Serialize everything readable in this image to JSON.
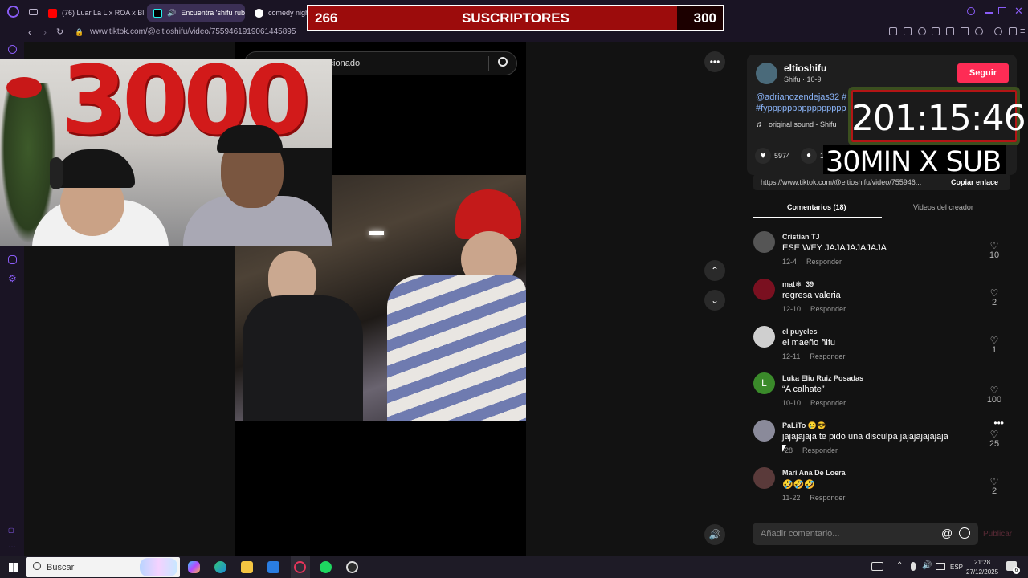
{
  "browser": {
    "tabs": [
      {
        "label": "(76) Luar La L x ROA x Bl",
        "color": "#ff0000"
      },
      {
        "label": "Encuentra 'shifu rub",
        "color": "#111111"
      },
      {
        "label": "comedy nigh",
        "color": "#9aa0a6"
      }
    ],
    "url": "www.tiktok.com/@eltioshifu/video/7559461919061445895"
  },
  "overlay": {
    "sub_current": "266",
    "sub_label": "SUSCRIPTORES",
    "sub_goal": "300",
    "sub_progress_fraction": 0.89,
    "timer": "201:15:46",
    "promo": "30MIN X SUB",
    "balloons": "3000"
  },
  "search": {
    "text": "lacionado"
  },
  "author": {
    "name": "eltioshifu",
    "subline": "Shifu · 10-9",
    "follow_label": "Seguir",
    "caption_line1": "@adrianozendejas32 #",
    "caption_line2": "#fypppppppppppppppp",
    "sound": "original sound - Shifu"
  },
  "stats": {
    "likes": "5974",
    "comments": "1"
  },
  "link": {
    "url": "https://www.tiktok.com/@eltioshifu/video/755946...",
    "copy_label": "Copiar enlace"
  },
  "tabs": {
    "comments": "Comentarios (18)",
    "creator_videos": "Videos del creador"
  },
  "reply_label": "Responder",
  "comments": [
    {
      "name": "Cristian TJ",
      "text": "ESE WEY JAJAJAJAJAJA",
      "date": "12-4",
      "likes": "10",
      "avatar_color": "#555"
    },
    {
      "name": "mat⚛_39",
      "text": "regresa valeria",
      "date": "12-10",
      "likes": "2",
      "avatar_color": "#7a1020"
    },
    {
      "name": "el puyeles",
      "text": "el maeño ñifu",
      "date": "12-11",
      "likes": "1",
      "avatar_color": "#cfcfcf"
    },
    {
      "name": "Luka Eliu Ruiz Posadas",
      "text": "“A calhate”",
      "date": "10-10",
      "likes": "100",
      "avatar_color": "#3a8a2a",
      "initial": "L"
    },
    {
      "name": "PaLiTo 🥲😎",
      "text": "jajajajaja te pido una disculpa jajajajajajaja",
      "date": "-28",
      "likes": "25",
      "avatar_color": "#8a8a9a"
    },
    {
      "name": "Mari Ana De Loera",
      "text": "🤣🤣🤣",
      "date": "11-22",
      "likes": "2",
      "avatar_color": "#5a3a3a"
    }
  ],
  "comment_input": {
    "placeholder": "Añadir comentario...",
    "post_label": "Publicar"
  },
  "taskbar": {
    "search_placeholder": "Buscar",
    "lang": "ESP",
    "time": "21:28",
    "date": "27/12/2025",
    "notif_count": "6"
  }
}
